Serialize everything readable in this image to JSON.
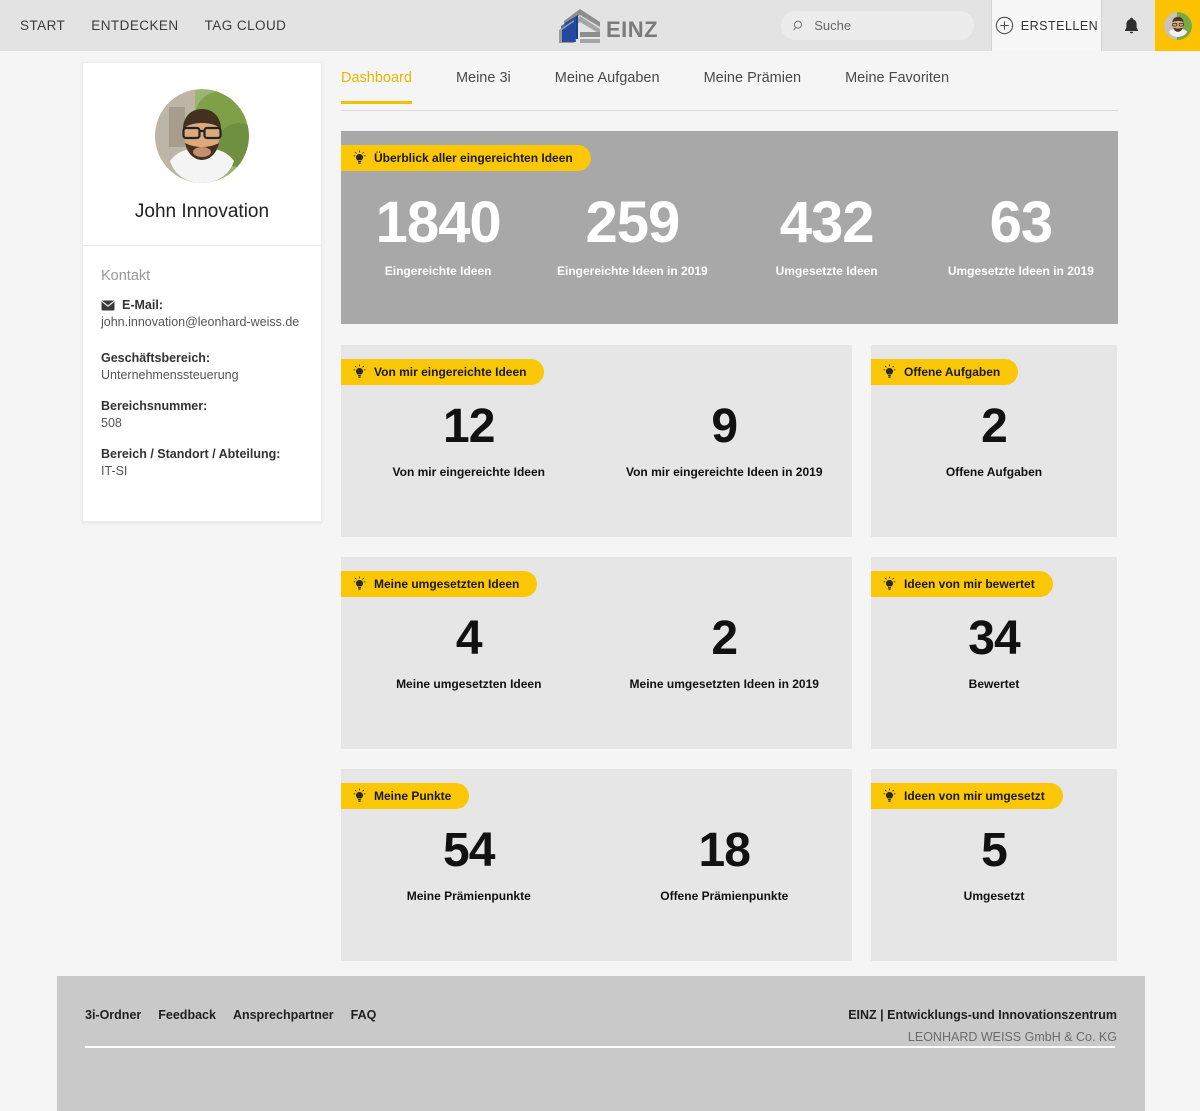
{
  "header": {
    "nav": [
      {
        "label": "START"
      },
      {
        "label": "ENTDECKEN"
      },
      {
        "label": "TAG CLOUD"
      }
    ],
    "brand_text": "EINZ",
    "brand_logo_icon": "einz-building-logo",
    "search": {
      "placeholder": "Suche",
      "value": "",
      "icon": "search-icon"
    },
    "create_button": {
      "label": "ERSTELLEN",
      "icon": "plus-circle-icon"
    },
    "notifications_icon": "bell-icon",
    "avatar_icon": "user-avatar",
    "accent_color": "#fcc200",
    "bar_color": "#e3e3e3"
  },
  "tabs": [
    {
      "label": "Dashboard",
      "active": true
    },
    {
      "label": "Meine 3i",
      "active": false
    },
    {
      "label": "Meine Aufgaben",
      "active": false
    },
    {
      "label": "Meine Prämien",
      "active": false
    },
    {
      "label": "Meine Favoriten",
      "active": false
    }
  ],
  "profile": {
    "avatar_icon": "user-avatar-large",
    "name": "John Innovation",
    "contact_heading": "Kontakt",
    "email_icon": "envelope-icon",
    "email_label": "E-Mail:",
    "email_value": "john.innovation@leonhard-weiss.de",
    "division_label": "Geschäftsbereich:",
    "division_value": "Unternehmenssteuerung",
    "division_number_label": "Bereichsnummer:",
    "division_number_value": "508",
    "location_label": "Bereich / Standort / Abteilung:",
    "location_value": "IT-SI"
  },
  "overview": {
    "tag_label": "Überblick aller eingereichten Ideen",
    "tag_icon": "lightbulb-icon",
    "background_color": "#a8a8a8",
    "stats": [
      {
        "value": "1840",
        "caption": "Eingereichte Ideen"
      },
      {
        "value": "259",
        "caption": "Eingereichte Ideen in 2019"
      },
      {
        "value": "432",
        "caption": "Umgesetzte Ideen"
      },
      {
        "value": "63",
        "caption": "Umgesetzte Ideen in 2019"
      }
    ]
  },
  "cards": {
    "submitted": {
      "tag_label": "Von mir eingereichte Ideen",
      "tag_icon": "lightbulb-icon",
      "stats": [
        {
          "value": "12",
          "caption": "Von mir eingereichte Ideen"
        },
        {
          "value": "9",
          "caption": "Von mir eingereichte Ideen in 2019"
        }
      ]
    },
    "open_tasks": {
      "tag_label": "Offene Aufgaben",
      "tag_icon": "lightbulb-icon",
      "stats": [
        {
          "value": "2",
          "caption": "Offene Aufgaben"
        }
      ]
    },
    "implemented": {
      "tag_label": "Meine umgesetzten Ideen",
      "tag_icon": "lightbulb-icon",
      "stats": [
        {
          "value": "4",
          "caption": "Meine umgesetzten Ideen"
        },
        {
          "value": "2",
          "caption": "Meine umgesetzten Ideen in 2019"
        }
      ]
    },
    "rated": {
      "tag_label": "Ideen von mir bewertet",
      "tag_icon": "lightbulb-icon",
      "stats": [
        {
          "value": "34",
          "caption": "Bewertet"
        }
      ]
    },
    "points": {
      "tag_label": "Meine Punkte",
      "tag_icon": "lightbulb-icon",
      "stats": [
        {
          "value": "54",
          "caption": "Meine Prämienpunkte"
        },
        {
          "value": "18",
          "caption": "Offene Prämienpunkte"
        }
      ]
    },
    "realized": {
      "tag_label": "Ideen von mir umgesetzt",
      "tag_icon": "lightbulb-icon",
      "stats": [
        {
          "value": "5",
          "caption": "Umgesetzt"
        }
      ]
    }
  },
  "footer": {
    "links": [
      {
        "label": "3i-Ordner"
      },
      {
        "label": "Feedback"
      },
      {
        "label": "Ansprechpartner"
      },
      {
        "label": "FAQ"
      }
    ],
    "company_line1": "EINZ | Entwicklungs-und Innovationszentrum",
    "company_line2": "LEONHARD WEISS GmbH & Co. KG"
  }
}
